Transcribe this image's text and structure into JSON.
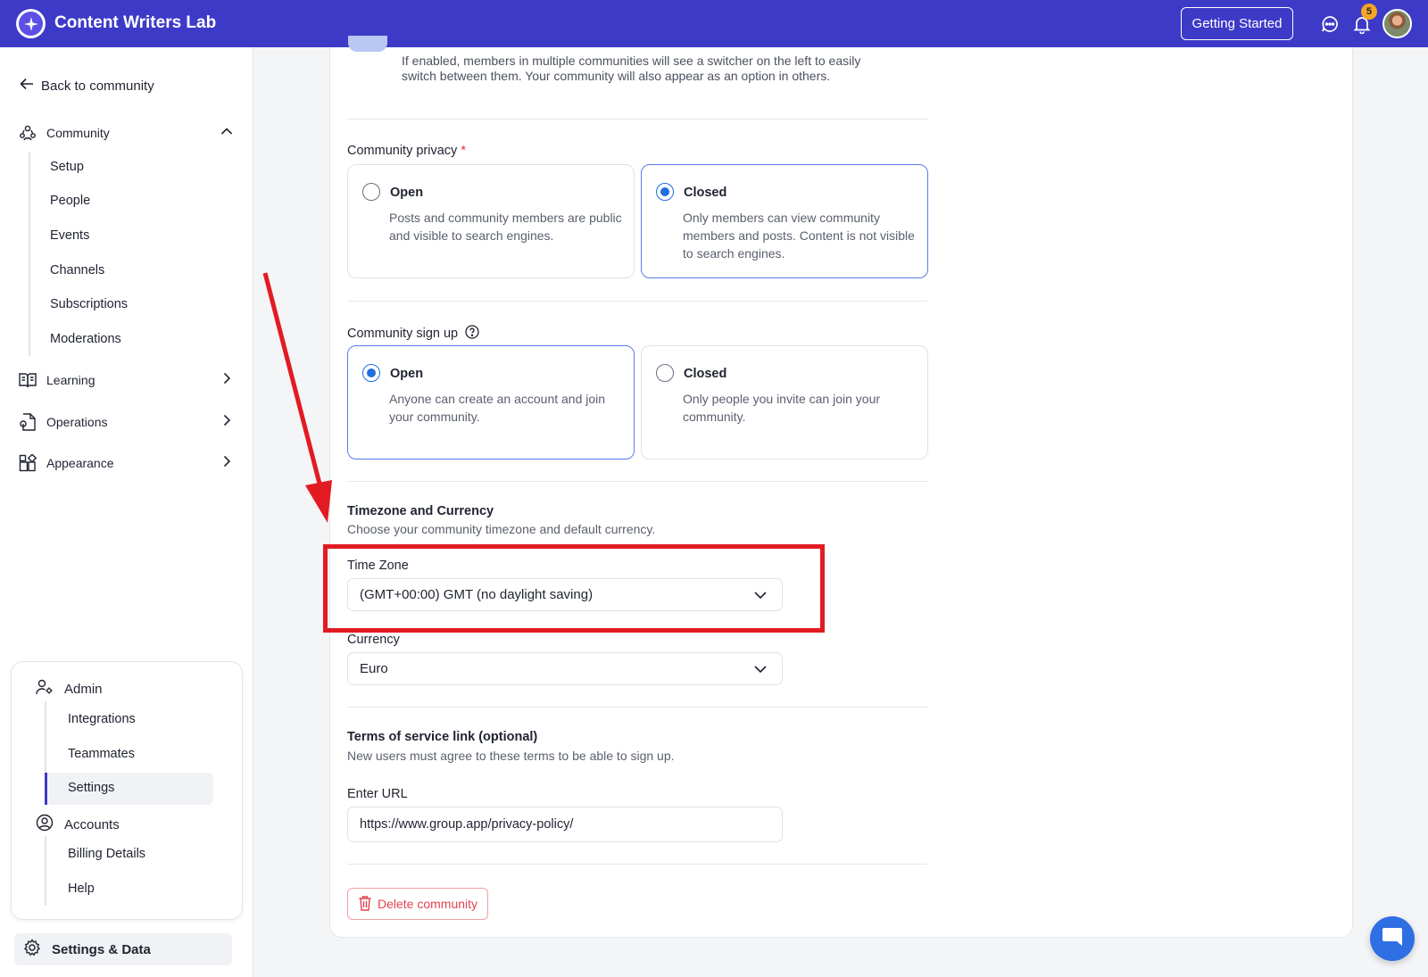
{
  "app": {
    "title": "Content Writers Lab"
  },
  "header": {
    "getting_started": "Getting Started",
    "notification_count": "5"
  },
  "sidebar": {
    "back": "Back to community",
    "groups": [
      {
        "label": "Community",
        "icon": "community-icon",
        "expanded": true,
        "items": [
          "Setup",
          "People",
          "Events",
          "Channels",
          "Subscriptions",
          "Moderations"
        ]
      },
      {
        "label": "Learning",
        "icon": "book-icon",
        "expanded": false
      },
      {
        "label": "Operations",
        "icon": "operations-icon",
        "expanded": false
      },
      {
        "label": "Appearance",
        "icon": "appearance-icon",
        "expanded": false
      }
    ],
    "admin": {
      "label": "Admin",
      "items": [
        "Integrations",
        "Teammates",
        "Settings"
      ],
      "active": "Settings"
    },
    "accounts": {
      "label": "Accounts",
      "items": [
        "Billing Details",
        "Help"
      ]
    },
    "settings_data": "Settings & Data"
  },
  "main": {
    "switcher_desc": "If enabled, members in multiple communities will see a switcher on the left to easily switch between them. Your community will also appear as an option in others.",
    "privacy": {
      "label": "Community privacy",
      "required_mark": "*",
      "options": [
        {
          "title": "Open",
          "desc": "Posts and community members are public and visible to search engines.",
          "selected": false
        },
        {
          "title": "Closed",
          "desc": "Only members can view community members and posts. Content is not visible to search engines.",
          "selected": true
        }
      ]
    },
    "signup": {
      "label": "Community sign up",
      "options": [
        {
          "title": "Open",
          "desc": "Anyone can create an account and join your community.",
          "selected": true
        },
        {
          "title": "Closed",
          "desc": "Only people you invite can join your community.",
          "selected": false
        }
      ]
    },
    "timezone_currency": {
      "title": "Timezone and Currency",
      "subtitle": "Choose your community timezone and default currency.",
      "timezone_label": "Time Zone",
      "timezone_value": "(GMT+00:00) GMT (no daylight saving)",
      "currency_label": "Currency",
      "currency_value": "Euro"
    },
    "terms": {
      "title": "Terms of service link (optional)",
      "subtitle": "New users must agree to these terms to be able to sign up.",
      "url_label": "Enter URL",
      "url_value": "https://www.group.app/privacy-policy/"
    },
    "delete_label": "Delete community"
  },
  "colors": {
    "brand": "#3d3ac8",
    "accent_blue": "#1e6fe0",
    "annotation_red": "#e21b23",
    "danger": "#e2434f"
  }
}
